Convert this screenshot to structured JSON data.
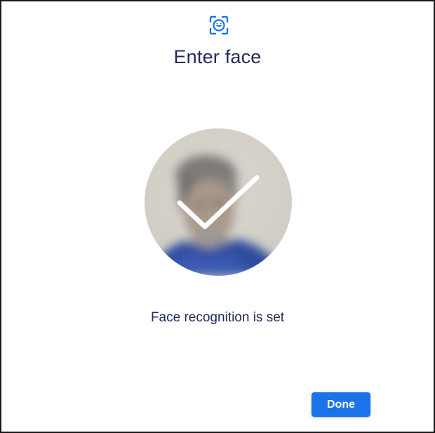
{
  "dialog": {
    "header_icon": "face-scan-icon",
    "title": "Enter face",
    "face_preview": {
      "overlay_icon": "checkmark-icon",
      "image": "blurred-face-photo"
    },
    "status_text": "Face recognition is set",
    "done_button_label": "Done"
  },
  "colors": {
    "accent": "#1a73e8",
    "title_text": "#1f2a5c",
    "background": "#ffffff",
    "border": "#1a1a1a"
  }
}
